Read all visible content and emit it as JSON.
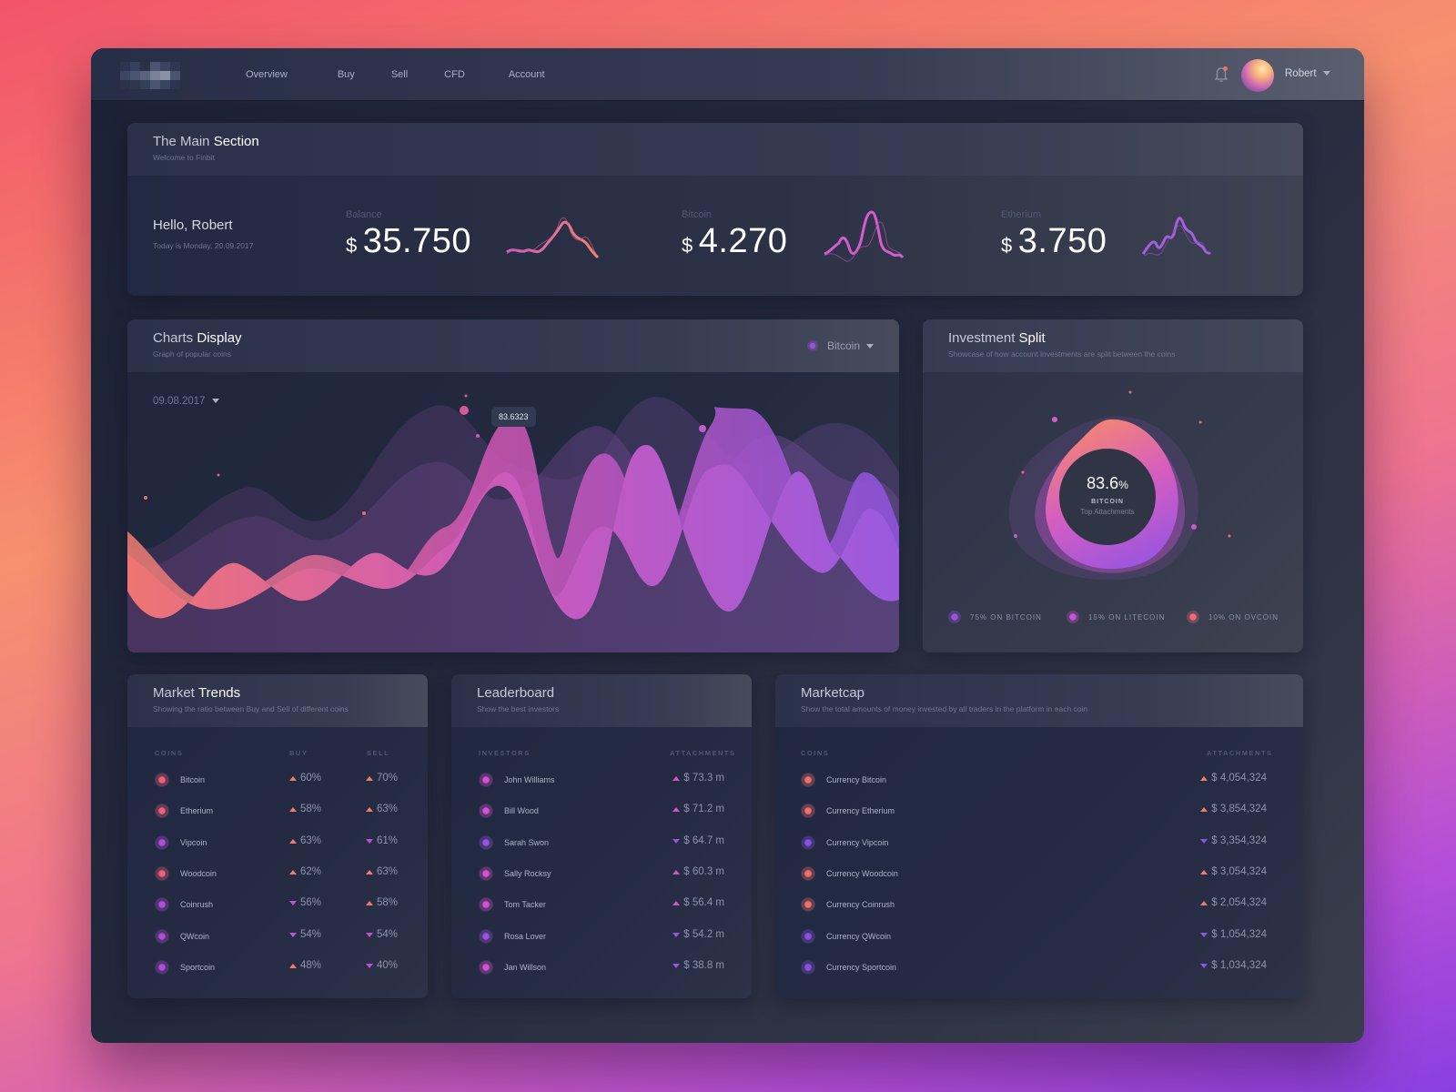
{
  "nav": {
    "items": [
      "Overview",
      "Buy",
      "Sell",
      "CFD",
      "Account"
    ],
    "user": "Robert",
    "icons": {
      "notification": "bell-icon",
      "user_menu": "chevron-down-icon"
    }
  },
  "main_section": {
    "title_light": "The Main",
    "title_bold": "Section",
    "subtitle": "Welcome to Finbit",
    "greeting": "Hello, Robert",
    "date_text": "Today is Monday, 20.09.2017",
    "stats": [
      {
        "label": "Balance",
        "currency": "$",
        "value": "35.750",
        "color": "#f07a6e"
      },
      {
        "label": "Bitcoin",
        "currency": "$",
        "value": "4.270",
        "color": "#d45ccf"
      },
      {
        "label": "Etherium",
        "currency": "$",
        "value": "3.750",
        "color": "#a45ee0"
      }
    ]
  },
  "charts_display": {
    "title_light": "Charts",
    "title_bold": "Display",
    "subtitle": "Graph of popular coins",
    "coin_selected": "Bitcoin",
    "date_selected": "09.08.2017",
    "tooltip_value": "83.6323"
  },
  "investment_split": {
    "title_light": "Investment",
    "title_bold": "Split",
    "subtitle": "Showcase of how account investments are split between the coins",
    "center_value": "83.6",
    "center_unit": "%",
    "center_coin": "BITCOIN",
    "center_label": "Top Attachments",
    "legend": [
      {
        "label": "75% ON BITCOIN",
        "color": "#9a52e0"
      },
      {
        "label": "15% ON LITECOIN",
        "color": "#c655d6"
      },
      {
        "label": "10% ON OVCOIN",
        "color": "#f06a78"
      }
    ]
  },
  "market_trends": {
    "title_light": "Market",
    "title_bold": "Trends",
    "subtitle": "Showing the ratio between Buy and Sell of different coins",
    "columns": [
      "COINS",
      "BUY",
      "SELL"
    ],
    "rows": [
      {
        "coin": "Bitcoin",
        "buy": "60%",
        "buy_dir": "up",
        "sell": "70%",
        "sell_dir": "up",
        "color": "#f0607a"
      },
      {
        "coin": "Etherium",
        "buy": "58%",
        "buy_dir": "up",
        "sell": "63%",
        "sell_dir": "up",
        "color": "#f0607a"
      },
      {
        "coin": "Vipcoin",
        "buy": "63%",
        "buy_dir": "up",
        "sell": "61%",
        "sell_dir": "down",
        "color": "#b04ed8"
      },
      {
        "coin": "Woodcoin",
        "buy": "62%",
        "buy_dir": "up",
        "sell": "63%",
        "sell_dir": "up",
        "color": "#f0607a"
      },
      {
        "coin": "Coinrush",
        "buy": "56%",
        "buy_dir": "down",
        "sell": "58%",
        "sell_dir": "up",
        "color": "#b04ed8"
      },
      {
        "coin": "QWcoin",
        "buy": "54%",
        "buy_dir": "down",
        "sell": "54%",
        "sell_dir": "down",
        "color": "#b04ed8"
      },
      {
        "coin": "Sportcoin",
        "buy": "48%",
        "buy_dir": "up",
        "sell": "40%",
        "sell_dir": "down",
        "color": "#b04ed8"
      }
    ]
  },
  "leaderboard": {
    "title": "Leaderboard",
    "subtitle": "Show the best investors",
    "columns": [
      "INVESTORS",
      "ATTACHMENTS"
    ],
    "rows": [
      {
        "name": "John Williams",
        "value": "$ 73.3 m",
        "dir": "up",
        "color": "#d452d0"
      },
      {
        "name": "Bill Wood",
        "value": "$ 71.2 m",
        "dir": "up",
        "color": "#d452d0"
      },
      {
        "name": "Sarah Swon",
        "value": "$ 64.7 m",
        "dir": "down",
        "color": "#9a52e0"
      },
      {
        "name": "Sally Rocksy",
        "value": "$ 60.3 m",
        "dir": "up",
        "color": "#d452d0"
      },
      {
        "name": "Tom Tacker",
        "value": "$ 56.4 m",
        "dir": "up",
        "color": "#d452d0"
      },
      {
        "name": "Rosa Lover",
        "value": "$ 54.2 m",
        "dir": "down",
        "color": "#9a52e0"
      },
      {
        "name": "Jan Willson",
        "value": "$ 38.8 m",
        "dir": "down",
        "color": "#d452d0"
      }
    ]
  },
  "marketcap": {
    "title": "Marketcap",
    "subtitle": "Show the total amounts of money invested by all traders in the platform in each coin",
    "columns": [
      "COINS",
      "ATTACHMENTS"
    ],
    "rows": [
      {
        "name": "Currency Bitcoin",
        "value": "$ 4,054,324",
        "dir": "up",
        "color": "#f0706a"
      },
      {
        "name": "Currency Etherium",
        "value": "$ 3,854,324",
        "dir": "up",
        "color": "#f0706a"
      },
      {
        "name": "Currency Vipcoin",
        "value": "$ 3,354,324",
        "dir": "down",
        "color": "#8a52e0"
      },
      {
        "name": "Currency Woodcoin",
        "value": "$ 3,054,324",
        "dir": "up",
        "color": "#f0706a"
      },
      {
        "name": "Currency Coinrush",
        "value": "$ 2,054,324",
        "dir": "up",
        "color": "#f0706a"
      },
      {
        "name": "Currency QWcoin",
        "value": "$ 1,054,324",
        "dir": "down",
        "color": "#8a52e0"
      },
      {
        "name": "Currency Sportcoin",
        "value": "$ 1,034,324",
        "dir": "down",
        "color": "#8a52e0"
      }
    ]
  }
}
